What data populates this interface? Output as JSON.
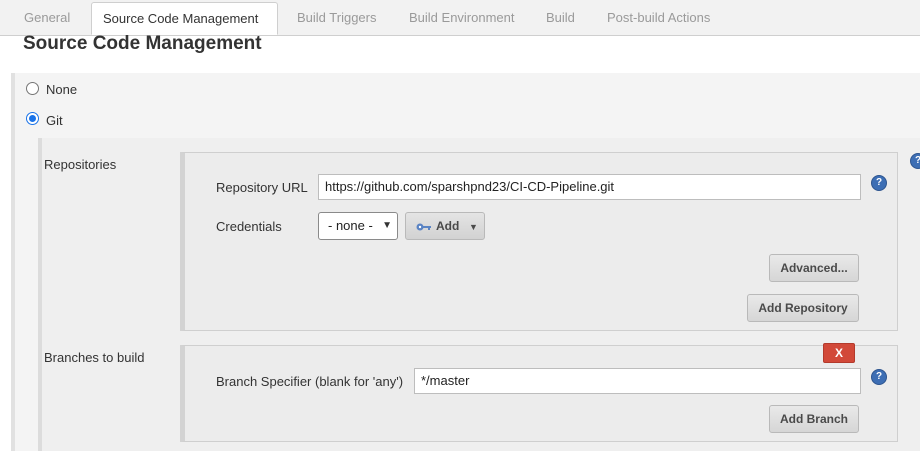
{
  "tabs": [
    {
      "label": "General"
    },
    {
      "label": "Source Code Management"
    },
    {
      "label": "Build Triggers"
    },
    {
      "label": "Build Environment"
    },
    {
      "label": "Build"
    },
    {
      "label": "Post-build Actions"
    }
  ],
  "heading": "Source Code Management",
  "scm_options": {
    "none_label": "None",
    "git_label": "Git",
    "selected": "Git"
  },
  "repositories": {
    "section_label": "Repositories",
    "url_label": "Repository URL",
    "url_value": "https://github.com/sparshpnd23/CI-CD-Pipeline.git",
    "credentials_label": "Credentials",
    "credentials_selected": "- none -",
    "add_label": "Add",
    "advanced_label": "Advanced...",
    "add_repository_label": "Add Repository"
  },
  "branches": {
    "section_label": "Branches to build",
    "delete_label": "X",
    "specifier_label": "Branch Specifier (blank for 'any')",
    "specifier_value": "*/master",
    "add_branch_label": "Add Branch"
  },
  "help_glyph": "?",
  "icons": {
    "help": "help-icon",
    "key": "key-icon",
    "chevron": "chevron-down-icon"
  },
  "colors": {
    "help_blue": "#3d6eb4",
    "delete_red": "#d24939",
    "radio_blue": "#1a73e8"
  }
}
